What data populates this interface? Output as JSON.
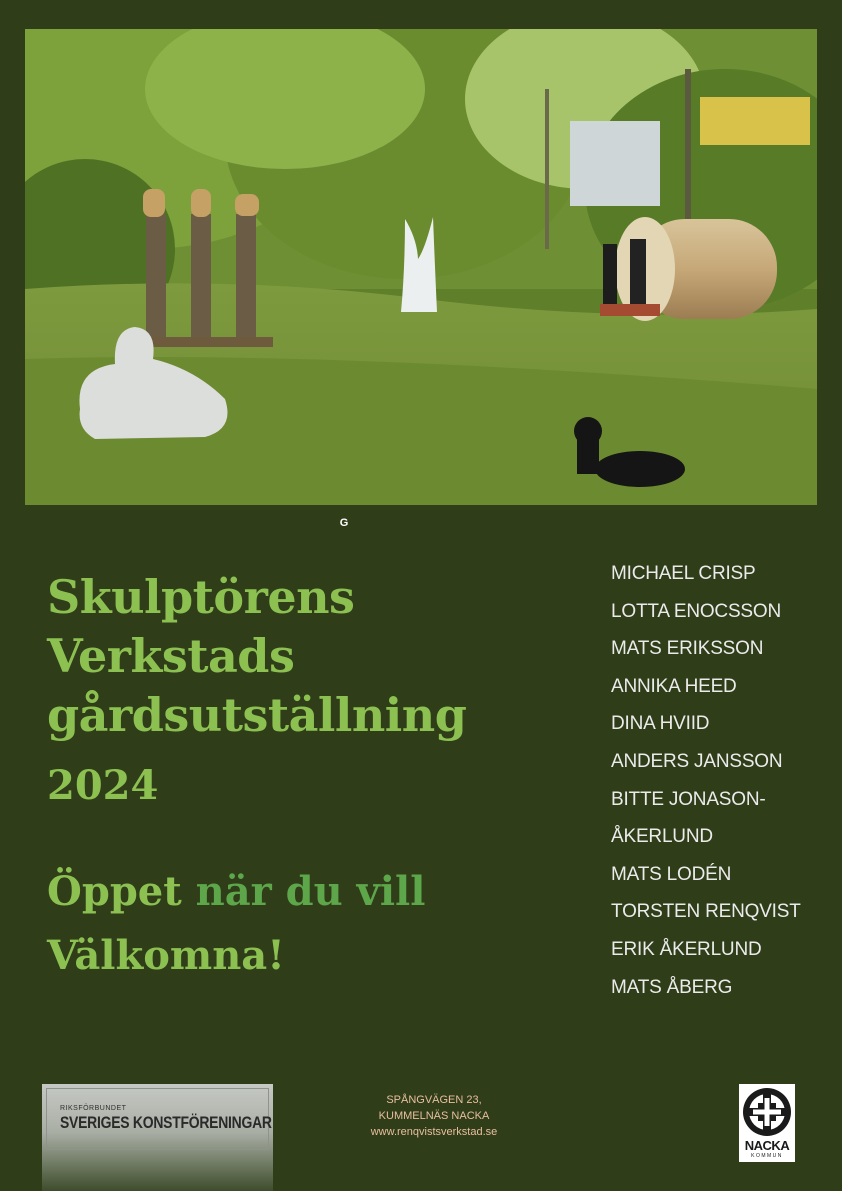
{
  "caption_letter": "G",
  "title": {
    "line1": "Skulptörens",
    "line2": "Verkstads",
    "line3": "gårdsutställning"
  },
  "year": "2024",
  "open": {
    "part1": "Öppet",
    "part2": " när du vill"
  },
  "welcome": "Välkomna!",
  "artists": [
    "MICHAEL CRISP",
    "LOTTA ENOCSSON",
    "MATS ERIKSSON",
    "ANNIKA HEED",
    "DINA HVIID",
    "ANDERS JANSSON",
    "BITTE JONASON-",
    "ÅKERLUND",
    "MATS LODÉN",
    "TORSTEN RENQVIST",
    "ERIK ÅKERLUND",
    "MATS ÅBERG"
  ],
  "footer": {
    "rk_small": "RIKSFÖRBUNDET",
    "rk_big": "SVERIGES KONSTFÖRENINGAR",
    "address_line1": "SPÅNGVÄGEN 23,",
    "address_line2": "KUMMELNÄS NACKA",
    "website": "www.renqvistsverkstad.se",
    "nacka_name": "NACKA",
    "nacka_sub": "KOMMUN"
  },
  "colors": {
    "background": "#2f3d19",
    "title_green": "#8cc152",
    "accent_green": "#5da64a",
    "list_text": "#ebebeb",
    "address_text": "#e8bfa0"
  }
}
